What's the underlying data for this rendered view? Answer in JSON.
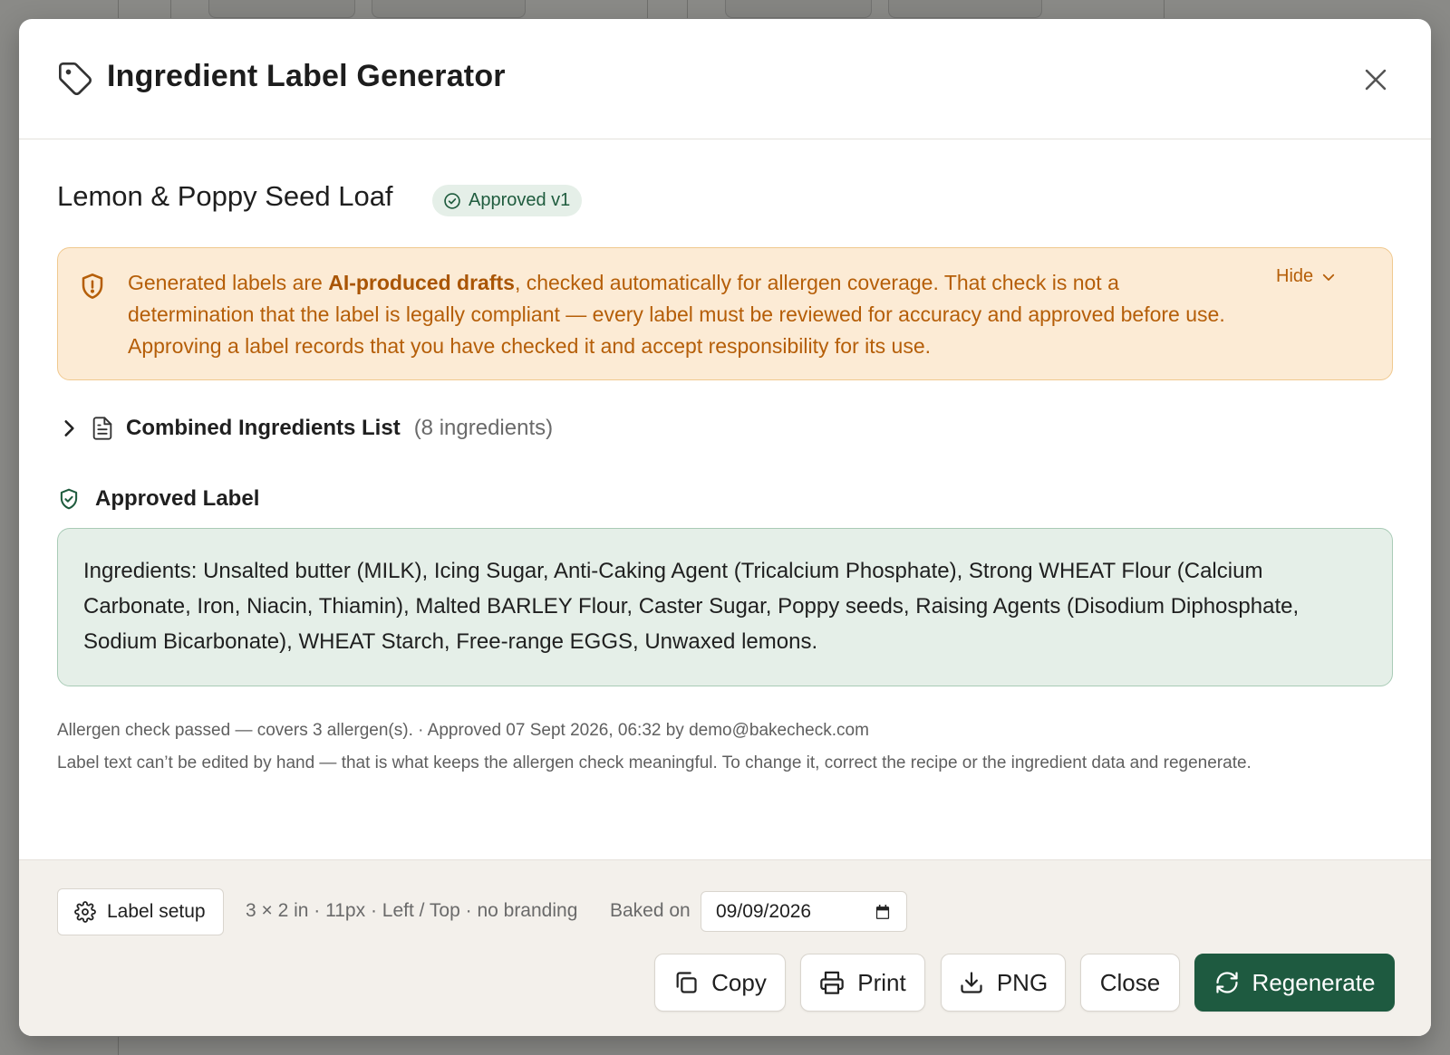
{
  "modal": {
    "title": "Ingredient Label Generator",
    "title_icon": "tag-icon",
    "close_icon": "close-icon"
  },
  "recipe": {
    "name": "Lemon & Poppy Seed Loaf",
    "status": "Approved v1",
    "status_icon": "check-circle-icon"
  },
  "notice": {
    "text_before": "Generated labels are ",
    "text_bold": "AI-produced drafts",
    "text_after": ", checked automatically for allergen coverage. That check is not a determination that the label is legally compliant — every label must be reviewed for accuracy and approved before use. Approving a label records that you have checked it and accept responsibility for its use.",
    "hide_label": "Hide",
    "icon": "shield-alert-icon"
  },
  "combined": {
    "title": "Combined Ingredients List",
    "count": "(8 ingredients)"
  },
  "approved": {
    "title": "Approved Label",
    "label_text": "Ingredients: Unsalted butter (MILK), Icing Sugar, Anti-Caking Agent (Tricalcium Phosphate), Strong WHEAT Flour (Calcium Carbonate, Iron, Niacin, Thiamin), Malted BARLEY Flour, Caster Sugar, Poppy seeds, Raising Agents (Disodium Diphosphate, Sodium Bicarbonate), WHEAT Starch, Free-range EGGS, Unwaxed lemons.",
    "meta": "Allergen check passed — covers 3 allergen(s). · Approved 07 Sept 2026, 06:32 by demo@bakecheck.com",
    "note": "Label text can’t be edited by hand — that is what keeps the allergen check meaningful. To change it, correct the recipe or the ingredient data and regenerate."
  },
  "footer": {
    "setup_label": "Label setup",
    "setup_summary": "3 × 2 in · 11px · Left / Top · no branding",
    "baked_label": "Baked on",
    "baked_date": "09/09/2026",
    "buttons": {
      "copy": "Copy",
      "print": "Print",
      "png": "PNG",
      "close": "Close",
      "regenerate": "Regenerate"
    }
  },
  "colors": {
    "primary": "#1e5a40",
    "warning_bg": "#fcebd5",
    "warning_text": "#b55e08",
    "success_bg": "#e5efe8"
  }
}
